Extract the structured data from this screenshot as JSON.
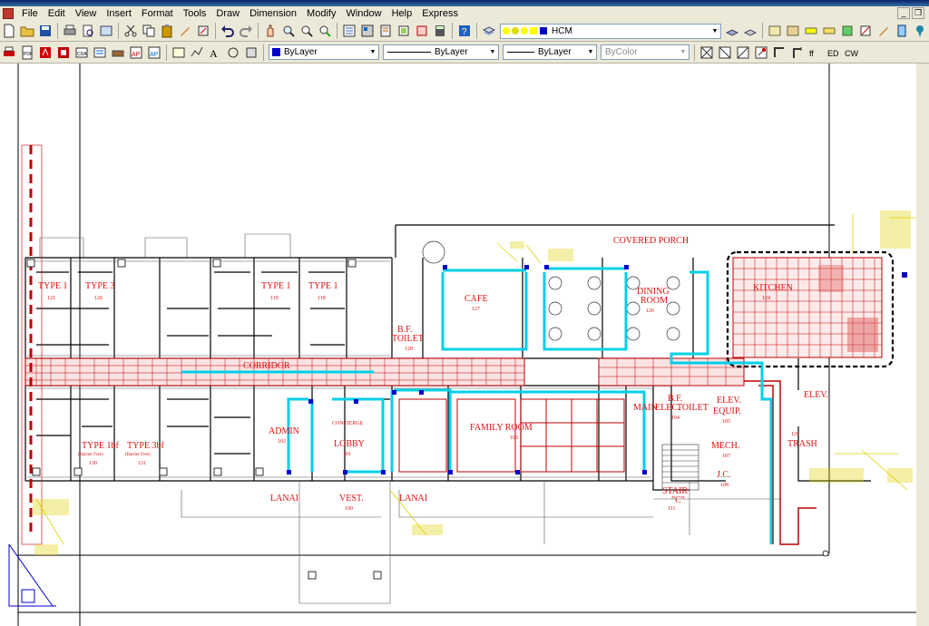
{
  "menu": {
    "items": [
      "File",
      "Edit",
      "View",
      "Insert",
      "Format",
      "Tools",
      "Draw",
      "Dimension",
      "Modify",
      "Window",
      "Help",
      "Express"
    ]
  },
  "toolbar": {
    "layer_name": "HCM",
    "color_value": "ByLayer",
    "linetype_value": "ByLayer",
    "lineweight_value": "ByLayer",
    "plotstyle_value": "ByColor"
  },
  "drawing": {
    "rooms": [
      "TYPE 1",
      "121",
      "TYPE 3",
      "120",
      "TYPE 1",
      "119",
      "TYPE 1",
      "118",
      "B.F.",
      "TOILET",
      "128",
      "CAFE",
      "127",
      "DINING",
      "ROOM",
      "126",
      "KITCHEN",
      "124",
      "COVERED PORCH",
      "CORRIDOR",
      "TYPE 1bf",
      "(Barrier Free)",
      "130",
      "TYPE 3bf",
      "(Barrier Free)",
      "131",
      "ADMIN",
      "102",
      "CONCIERGE",
      "LOBBY",
      "101",
      "FAMILY ROOM",
      "103",
      "MAIN",
      "ELEC.",
      "B.F.",
      "TOILET",
      "104",
      "ELEV.",
      "EQUIP.",
      "105",
      "MECH.",
      "107",
      "J.C.",
      "108",
      "STAIR",
      "\"C\"",
      "111",
      "ELEV.",
      "TRASH",
      "125",
      "LANAI",
      "VEST.",
      "100",
      "LANAI"
    ]
  },
  "colors": {
    "room_text": "#e01010",
    "walls": "#000000",
    "duct": "#00d0e8",
    "corridor_hatch": "#c00000",
    "notes": "#e0d000",
    "accent_blue": "#0000cc"
  }
}
